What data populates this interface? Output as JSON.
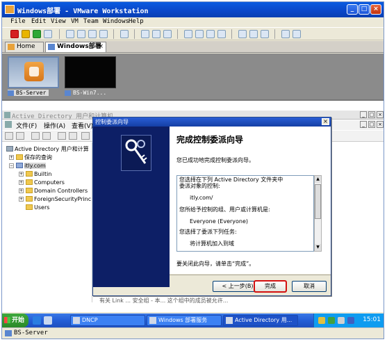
{
  "vmware": {
    "title": "Windows部署 - VMware Workstation",
    "menu": [
      "File",
      "Edit",
      "View",
      "VM",
      "Team",
      "Windows",
      "Help"
    ],
    "tabs": [
      "Home",
      "Windows部署"
    ],
    "tab_close": "×",
    "thumbnails": [
      "BS-Server",
      "BS-Win7..."
    ],
    "status": "BS-Server"
  },
  "ad_console": {
    "title": "Active Directory 用户和计算机",
    "menu": [
      "文件(F)",
      "操作(A)",
      "查看(V)"
    ],
    "tree": {
      "root": "Active Directory 用户和计算",
      "saved": "保存的查询",
      "domain": "itly.com",
      "children": [
        "Builtin",
        "Computers",
        "Domain Controllers",
        "ForeignSecurityPrinc",
        "Users"
      ]
    },
    "bottom_fragment": "有关 Link ...   安全组 - 本...   这个组中的成员被允许..."
  },
  "wizard": {
    "title": "控制委派向导",
    "heading": "完成控制委派向导",
    "subtitle": "您已成功地完成控制委派向导。",
    "summary": [
      "您选择在下列 Active Directory 文件夹中",
      "委派对象的控制:",
      "",
      "itly.com/",
      "",
      "您所给予控制的组、用户或计算机是:",
      "",
      "Everyone (Everyone)",
      "",
      "您选择了委派下列任务:",
      "",
      "将计算机加入到域"
    ],
    "close_message": "要关闭此向导，请单击“完成”。",
    "buttons": {
      "back": "< 上一步(B)",
      "finish": "完成",
      "cancel": "取消"
    },
    "close_symbol": "×"
  },
  "taskbar": {
    "start": "开始",
    "tasks": [
      "DNCP",
      "Windows 部署服务",
      "Active Directory 用..."
    ],
    "clock": "15:01"
  },
  "colors": {
    "titlebar": "#0a46c8",
    "wizard_side": "#0d1f66",
    "highlight": "#d41010"
  }
}
